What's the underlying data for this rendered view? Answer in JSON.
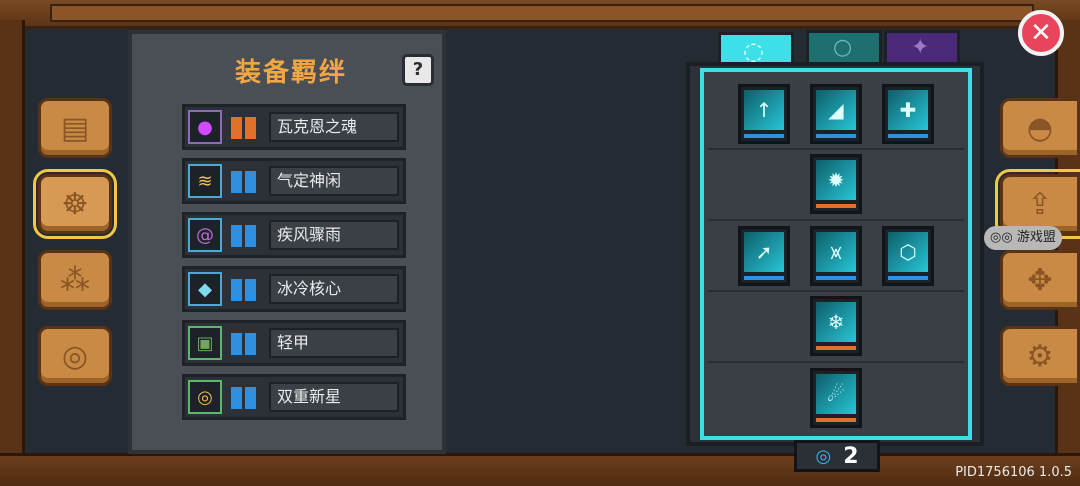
{
  "panel": {
    "title": "装备羁绊",
    "help_label": "?"
  },
  "bonds": [
    {
      "name": "瓦克恩之魂",
      "icon": "purple-soul-icon",
      "tier_color": "#e0702b",
      "border": "#8d6bbb"
    },
    {
      "name": "气定神闲",
      "icon": "calm-wave-icon",
      "tier_color": "#2f8fe0",
      "border": "#4aa9d6"
    },
    {
      "name": "疾风骤雨",
      "icon": "tornado-icon",
      "tier_color": "#2f8fe0",
      "border": "#4aa9d6"
    },
    {
      "name": "冰冷核心",
      "icon": "ice-crystal-icon",
      "tier_color": "#2f8fe0",
      "border": "#4aa9d6"
    },
    {
      "name": "轻甲",
      "icon": "light-armor-icon",
      "tier_color": "#2f8fe0",
      "border": "#5cb86a"
    },
    {
      "name": "双重新星",
      "icon": "double-nova-icon",
      "tier_color": "#2f8fe0",
      "border": "#5cb86a"
    }
  ],
  "skill_tree": {
    "points": "2"
  },
  "footer": {
    "pid": "PID1756106 1.0.5"
  },
  "watermark": "游戏盟"
}
